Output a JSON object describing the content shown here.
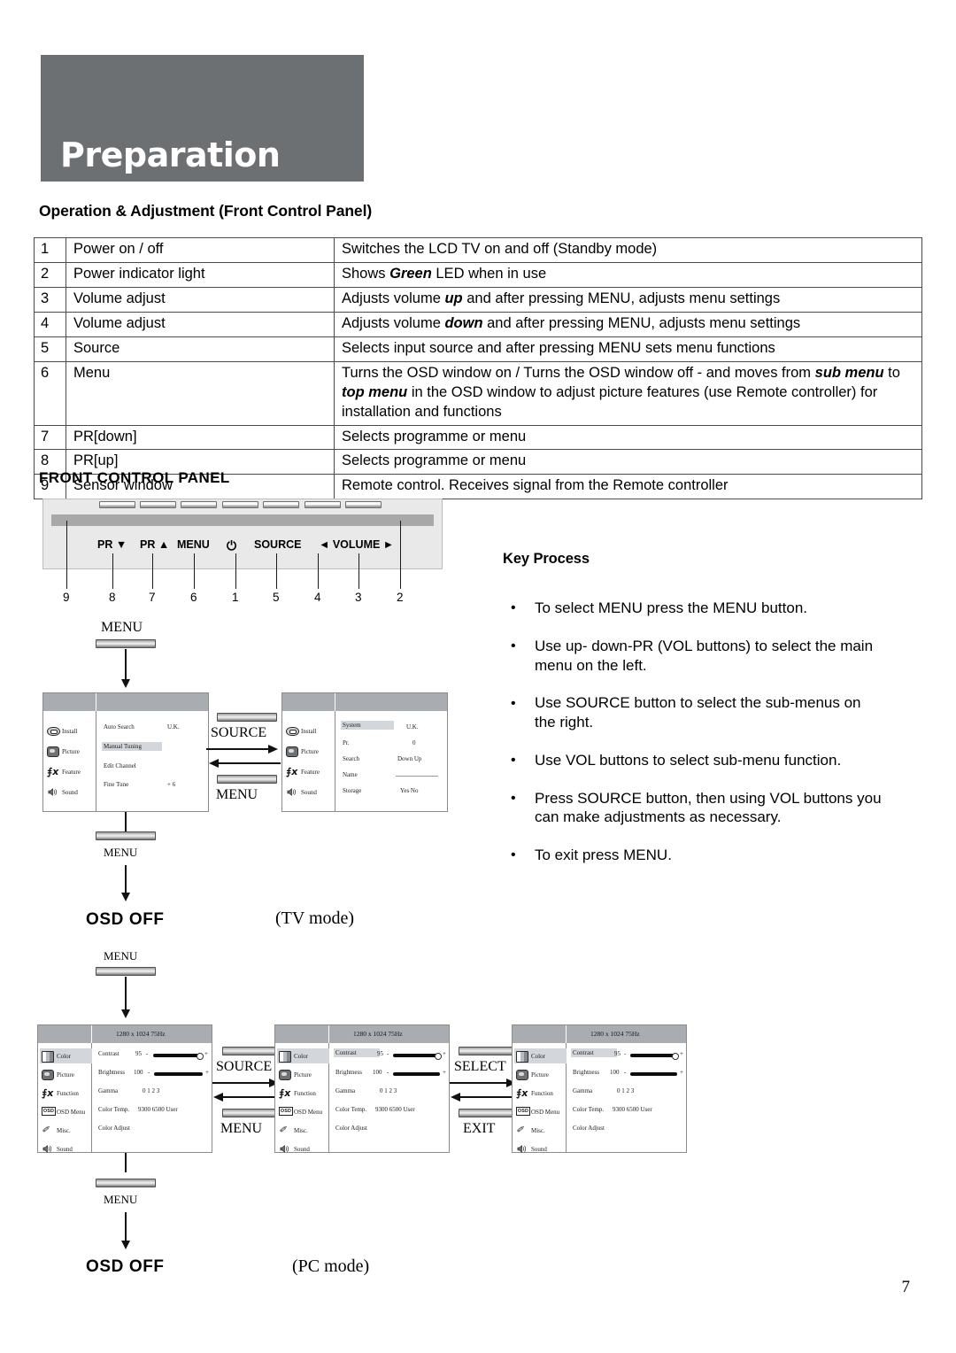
{
  "header": {
    "banner_title": "Preparation",
    "banner_color": "#6d7073"
  },
  "operation_section": {
    "heading": "Operation & Adjustment (Front Control Panel)",
    "rows": [
      {
        "num": "1",
        "label": "Power on / off",
        "desc": "Switches the LCD TV on and off (Standby mode)"
      },
      {
        "num": "2",
        "label": "Power indicator light",
        "desc": "Shows Green LED when in use",
        "desc_parts": [
          {
            "t": "Shows ",
            "b": false
          },
          {
            "t": "Green",
            "b": true
          },
          {
            "t": " LED when in use",
            "b": false
          }
        ]
      },
      {
        "num": "3",
        "label": "Volume adjust",
        "desc": "Adjusts volume up and after pressing MENU, adjusts menu settings"
      },
      {
        "num": "4",
        "label": "Volume adjust",
        "desc": "Adjusts volume down and after pressing MENU, adjusts menu settings"
      },
      {
        "num": "5",
        "label": "Source",
        "desc": "Selects input source and after pressing MENU sets menu functions"
      },
      {
        "num": "6",
        "label": "Menu",
        "desc": "Turns the OSD window on / Turns the OSD window off - and moves from sub menu to top menu in the OSD window to adjust picture features (use Remote controller) for installation and functions"
      },
      {
        "num": "7",
        "label": "PR[down]",
        "desc": "Selects programme or menu"
      },
      {
        "num": "8",
        "label": "PR[up]",
        "desc": "Selects programme or menu"
      },
      {
        "num": "9",
        "label": "Sensor window",
        "desc": "Remote control. Receives signal from the Remote controller"
      }
    ]
  },
  "front_control_panel": {
    "heading": "FRONT CONTROL PANEL",
    "button_labels": [
      "PR ▼",
      "PR ▲",
      "MENU",
      "⏻",
      "SOURCE",
      "◄ VOLUME ►"
    ],
    "callout_numbers": [
      "9",
      "8",
      "7",
      "6",
      "1",
      "5",
      "4",
      "3",
      "2"
    ]
  },
  "key_process": {
    "heading": "Key Process",
    "bullet": "•",
    "items": [
      "To select MENU press the MENU button.",
      "Use up- down-PR (VOL buttons) to select the main menu on the left.",
      "Use SOURCE button to select the sub-menus on the right.",
      "Use VOL buttons to select sub-menu function.",
      "Press SOURCE button, then using VOL buttons you can make adjustments as necessary.",
      "To exit press MENU."
    ]
  },
  "tv_flow": {
    "menu_top_label": "MENU",
    "source_label": "SOURCE",
    "menu_mid_label": "MENU",
    "menu_bottom_label": "MENU",
    "osd_off_label": "OSD OFF",
    "mode_label": "(TV mode)",
    "panel_left": {
      "sidebar": [
        {
          "label": "Install",
          "icon": "install-icon",
          "selected": false
        },
        {
          "label": "Picture",
          "icon": "picture-icon",
          "selected": false
        },
        {
          "label": "Feature",
          "icon": "fx-icon",
          "selected": false
        },
        {
          "label": "Sound",
          "icon": "sound-icon",
          "selected": false
        }
      ],
      "rows": [
        {
          "name": "Auto Search",
          "value": "U.K.",
          "highlighted": false
        },
        {
          "name": "Manual Tuning",
          "value": "",
          "highlighted": true
        },
        {
          "name": "Edit Channel",
          "value": "",
          "highlighted": false
        },
        {
          "name": "Fine Tune",
          "value": "+ 6",
          "highlighted": false
        }
      ]
    },
    "panel_right": {
      "sidebar": [
        {
          "label": "Install",
          "icon": "install-icon",
          "selected": false
        },
        {
          "label": "Picture",
          "icon": "picture-icon",
          "selected": false
        },
        {
          "label": "Feature",
          "icon": "fx-icon",
          "selected": false
        },
        {
          "label": "Sound",
          "icon": "sound-icon",
          "selected": false
        }
      ],
      "rows": [
        {
          "name": "System",
          "value": "U.K.",
          "highlighted": true
        },
        {
          "name": "Pr.",
          "value": "0",
          "highlighted": false
        },
        {
          "name": "Search",
          "value": "Down   Up",
          "highlighted": false
        },
        {
          "name": "Name",
          "value": "",
          "highlighted": false
        },
        {
          "name": "Storage",
          "value": "Yes   No",
          "highlighted": false
        }
      ]
    }
  },
  "pc_flow": {
    "menu_top_label": "MENU",
    "source_label": "SOURCE",
    "menu_mid_label": "MENU",
    "select_label": "SELECT",
    "exit_label": "EXIT",
    "menu_bottom_label": "MENU",
    "osd_off_label": "OSD OFF",
    "mode_label": "(PC mode)",
    "resolution": "1280 x 1024     75Hz",
    "sidebar": [
      {
        "label": "Color",
        "icon": "color-icon",
        "selected": true
      },
      {
        "label": "Picture",
        "icon": "picture-icon",
        "selected": false
      },
      {
        "label": "Function",
        "icon": "fx-icon",
        "selected": false
      },
      {
        "label": "OSD Menu",
        "icon": "osd-icon",
        "selected": false
      },
      {
        "label": "Misc.",
        "icon": "misc-icon",
        "selected": false
      },
      {
        "label": "Sound",
        "icon": "sound-icon",
        "selected": false
      }
    ],
    "rows": [
      {
        "name": "Contrast",
        "value": "95",
        "minus": "-",
        "plus": "+",
        "type": "slider",
        "fill_pct": 92
      },
      {
        "name": "Brightness",
        "value": "100",
        "minus": "-",
        "plus": "+",
        "type": "slider",
        "fill_pct": 100
      },
      {
        "name": "Gamma",
        "value": "0    1    2    3",
        "type": "options"
      },
      {
        "name": "Color Temp.",
        "value": "9300        6500        User",
        "type": "options"
      },
      {
        "name": "Color Adjust",
        "value": "",
        "type": "plain"
      }
    ],
    "panel_highlight": {
      "panel1_row": null,
      "panel2_row": "Contrast",
      "panel3_row": "Contrast"
    }
  },
  "page_number": "7"
}
